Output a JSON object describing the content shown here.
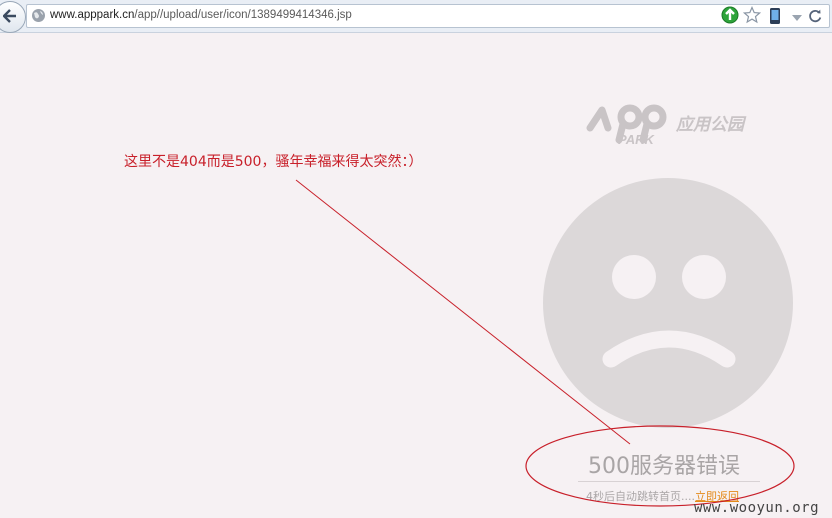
{
  "browser": {
    "url_host": "www.apppark.cn",
    "url_path": "/app//upload/user/icon/1389499414346.jsp"
  },
  "logo": {
    "mark_text": "APP PARK",
    "brand_text": "应用公园"
  },
  "annotation": {
    "text": "这里不是404而是500，骚年幸福来得太突然：）"
  },
  "error": {
    "title": "500服务器错误",
    "redirect_text": "4秒后自动跳转首页....",
    "back_link": "立即返回"
  },
  "watermark": "www.wooyun.org",
  "colors": {
    "annotation": "#c8202a",
    "link": "#e48a1a",
    "face": "#dcd8d9"
  }
}
